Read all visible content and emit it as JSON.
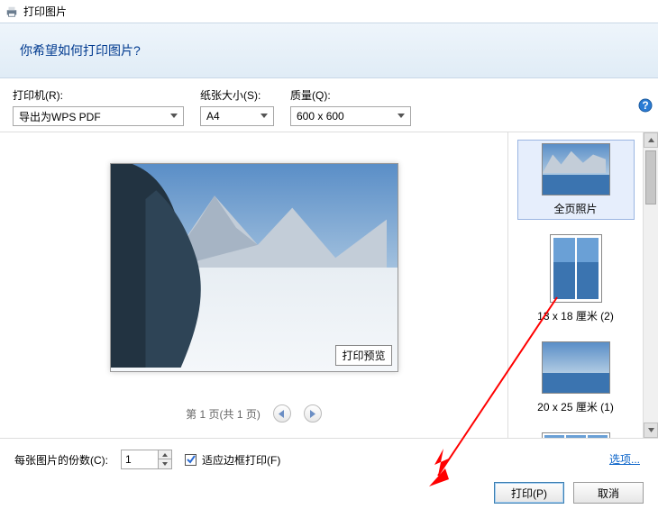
{
  "window": {
    "title": "打印图片"
  },
  "header": {
    "question": "你希望如何打印图片?"
  },
  "fields": {
    "printer": {
      "label": "打印机(R):",
      "value": "导出为WPS PDF"
    },
    "paper": {
      "label": "纸张大小(S):",
      "value": "A4"
    },
    "quality": {
      "label": "质量(Q):",
      "value": "600 x 600"
    }
  },
  "preview": {
    "tooltip": "打印预览",
    "pager": "第 1 页(共 1 页)"
  },
  "layouts": [
    {
      "label": "全页照片",
      "orientation": "landscape",
      "selected": true,
      "columns": 1
    },
    {
      "label": "13 x 18 厘米 (2)",
      "orientation": "portrait",
      "selected": false,
      "columns": 2
    },
    {
      "label": "20 x 25 厘米 (1)",
      "orientation": "landscape",
      "selected": false,
      "columns": 1
    },
    {
      "label": "",
      "orientation": "landscape",
      "selected": false,
      "columns": 3
    }
  ],
  "footer": {
    "copies_label": "每张图片的份数(C):",
    "copies_value": "1",
    "fit_frame_label": "适应边框打印(F)",
    "fit_frame_checked": true,
    "options_link": "选项..."
  },
  "buttons": {
    "print": "打印(P)",
    "cancel": "取消"
  }
}
